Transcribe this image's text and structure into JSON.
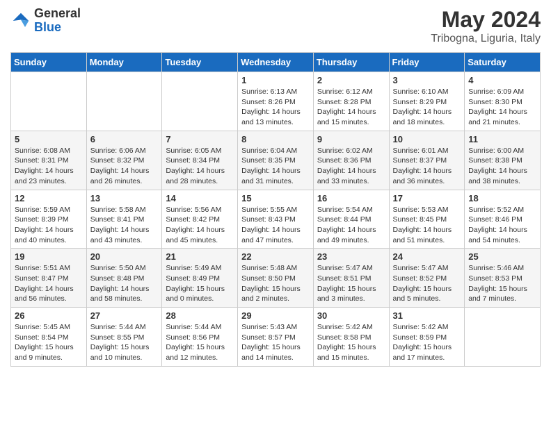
{
  "header": {
    "logo_general": "General",
    "logo_blue": "Blue",
    "main_title": "May 2024",
    "subtitle": "Tribogna, Liguria, Italy"
  },
  "calendar": {
    "days_of_week": [
      "Sunday",
      "Monday",
      "Tuesday",
      "Wednesday",
      "Thursday",
      "Friday",
      "Saturday"
    ],
    "weeks": [
      [
        {
          "day": "",
          "info": ""
        },
        {
          "day": "",
          "info": ""
        },
        {
          "day": "",
          "info": ""
        },
        {
          "day": "1",
          "info": "Sunrise: 6:13 AM\nSunset: 8:26 PM\nDaylight: 14 hours\nand 13 minutes."
        },
        {
          "day": "2",
          "info": "Sunrise: 6:12 AM\nSunset: 8:28 PM\nDaylight: 14 hours\nand 15 minutes."
        },
        {
          "day": "3",
          "info": "Sunrise: 6:10 AM\nSunset: 8:29 PM\nDaylight: 14 hours\nand 18 minutes."
        },
        {
          "day": "4",
          "info": "Sunrise: 6:09 AM\nSunset: 8:30 PM\nDaylight: 14 hours\nand 21 minutes."
        }
      ],
      [
        {
          "day": "5",
          "info": "Sunrise: 6:08 AM\nSunset: 8:31 PM\nDaylight: 14 hours\nand 23 minutes."
        },
        {
          "day": "6",
          "info": "Sunrise: 6:06 AM\nSunset: 8:32 PM\nDaylight: 14 hours\nand 26 minutes."
        },
        {
          "day": "7",
          "info": "Sunrise: 6:05 AM\nSunset: 8:34 PM\nDaylight: 14 hours\nand 28 minutes."
        },
        {
          "day": "8",
          "info": "Sunrise: 6:04 AM\nSunset: 8:35 PM\nDaylight: 14 hours\nand 31 minutes."
        },
        {
          "day": "9",
          "info": "Sunrise: 6:02 AM\nSunset: 8:36 PM\nDaylight: 14 hours\nand 33 minutes."
        },
        {
          "day": "10",
          "info": "Sunrise: 6:01 AM\nSunset: 8:37 PM\nDaylight: 14 hours\nand 36 minutes."
        },
        {
          "day": "11",
          "info": "Sunrise: 6:00 AM\nSunset: 8:38 PM\nDaylight: 14 hours\nand 38 minutes."
        }
      ],
      [
        {
          "day": "12",
          "info": "Sunrise: 5:59 AM\nSunset: 8:39 PM\nDaylight: 14 hours\nand 40 minutes."
        },
        {
          "day": "13",
          "info": "Sunrise: 5:58 AM\nSunset: 8:41 PM\nDaylight: 14 hours\nand 43 minutes."
        },
        {
          "day": "14",
          "info": "Sunrise: 5:56 AM\nSunset: 8:42 PM\nDaylight: 14 hours\nand 45 minutes."
        },
        {
          "day": "15",
          "info": "Sunrise: 5:55 AM\nSunset: 8:43 PM\nDaylight: 14 hours\nand 47 minutes."
        },
        {
          "day": "16",
          "info": "Sunrise: 5:54 AM\nSunset: 8:44 PM\nDaylight: 14 hours\nand 49 minutes."
        },
        {
          "day": "17",
          "info": "Sunrise: 5:53 AM\nSunset: 8:45 PM\nDaylight: 14 hours\nand 51 minutes."
        },
        {
          "day": "18",
          "info": "Sunrise: 5:52 AM\nSunset: 8:46 PM\nDaylight: 14 hours\nand 54 minutes."
        }
      ],
      [
        {
          "day": "19",
          "info": "Sunrise: 5:51 AM\nSunset: 8:47 PM\nDaylight: 14 hours\nand 56 minutes."
        },
        {
          "day": "20",
          "info": "Sunrise: 5:50 AM\nSunset: 8:48 PM\nDaylight: 14 hours\nand 58 minutes."
        },
        {
          "day": "21",
          "info": "Sunrise: 5:49 AM\nSunset: 8:49 PM\nDaylight: 15 hours\nand 0 minutes."
        },
        {
          "day": "22",
          "info": "Sunrise: 5:48 AM\nSunset: 8:50 PM\nDaylight: 15 hours\nand 2 minutes."
        },
        {
          "day": "23",
          "info": "Sunrise: 5:47 AM\nSunset: 8:51 PM\nDaylight: 15 hours\nand 3 minutes."
        },
        {
          "day": "24",
          "info": "Sunrise: 5:47 AM\nSunset: 8:52 PM\nDaylight: 15 hours\nand 5 minutes."
        },
        {
          "day": "25",
          "info": "Sunrise: 5:46 AM\nSunset: 8:53 PM\nDaylight: 15 hours\nand 7 minutes."
        }
      ],
      [
        {
          "day": "26",
          "info": "Sunrise: 5:45 AM\nSunset: 8:54 PM\nDaylight: 15 hours\nand 9 minutes."
        },
        {
          "day": "27",
          "info": "Sunrise: 5:44 AM\nSunset: 8:55 PM\nDaylight: 15 hours\nand 10 minutes."
        },
        {
          "day": "28",
          "info": "Sunrise: 5:44 AM\nSunset: 8:56 PM\nDaylight: 15 hours\nand 12 minutes."
        },
        {
          "day": "29",
          "info": "Sunrise: 5:43 AM\nSunset: 8:57 PM\nDaylight: 15 hours\nand 14 minutes."
        },
        {
          "day": "30",
          "info": "Sunrise: 5:42 AM\nSunset: 8:58 PM\nDaylight: 15 hours\nand 15 minutes."
        },
        {
          "day": "31",
          "info": "Sunrise: 5:42 AM\nSunset: 8:59 PM\nDaylight: 15 hours\nand 17 minutes."
        },
        {
          "day": "",
          "info": ""
        }
      ]
    ]
  }
}
